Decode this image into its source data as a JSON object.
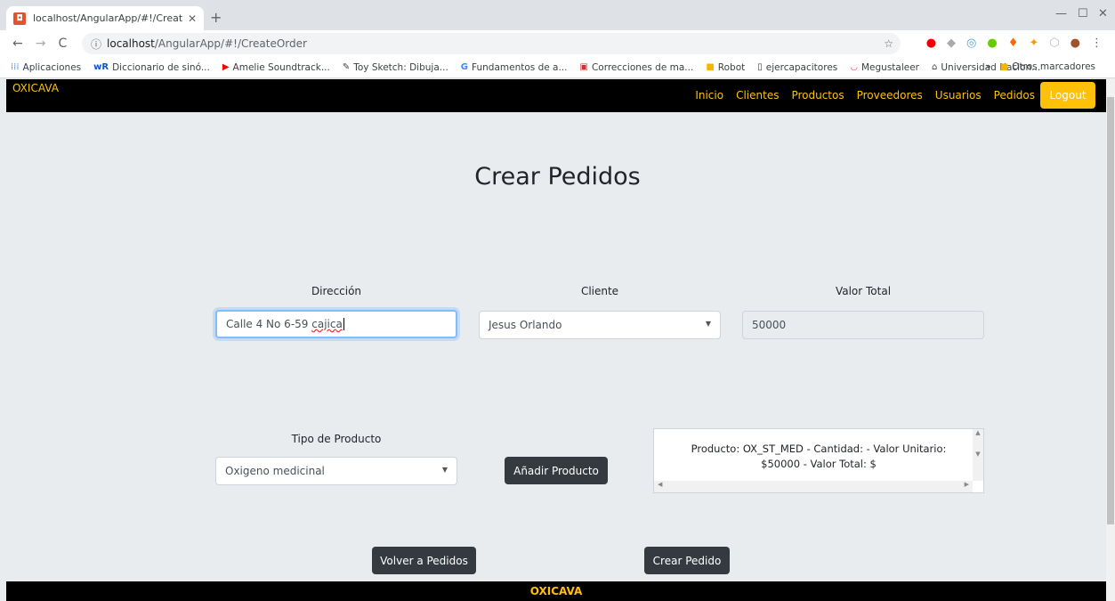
{
  "browser": {
    "tab_title": "localhost/AngularApp/#!/Create(",
    "url_host": "localhost",
    "url_path": "/AngularApp/#!/CreateOrder",
    "bookmarks": [
      "Aplicaciones",
      "Diccionario de sinó...",
      "Amelie Soundtrack...",
      "Toy Sketch: Dibuja...",
      "Fundamentos de a...",
      "Correcciones de ma...",
      "Robot",
      "ejercapacitores",
      "Megustaleer",
      "Universidad Nacion..."
    ],
    "bookmarks_more": "»",
    "other_bookmarks": "Otros marcadores"
  },
  "nav": {
    "brand": "OXICAVA",
    "links": [
      "Inicio",
      "Clientes",
      "Productos",
      "Proveedores",
      "Usuarios",
      "Pedidos"
    ],
    "logout": "Logout"
  },
  "page": {
    "title": "Crear Pedidos",
    "direccion_label": "Dirección",
    "direccion_value": "Calle 4 No 6-59",
    "direccion_value_misspelled": "cajica",
    "cliente_label": "Cliente",
    "cliente_value": "Jesus Orlando",
    "valor_total_label": "Valor Total",
    "valor_total_value": "50000",
    "tipo_producto_label": "Tipo de Producto",
    "tipo_producto_value": "Oxigeno medicinal",
    "add_product_button": "Añadir Producto",
    "product_line_1": "Producto: OX_ST_MED - Cantidad: - Valor Unitario:",
    "product_line_2": "$50000 - Valor Total: $",
    "back_button": "Volver a Pedidos",
    "create_button": "Crear Pedido"
  },
  "footer": {
    "brand": "OXICAVA"
  }
}
